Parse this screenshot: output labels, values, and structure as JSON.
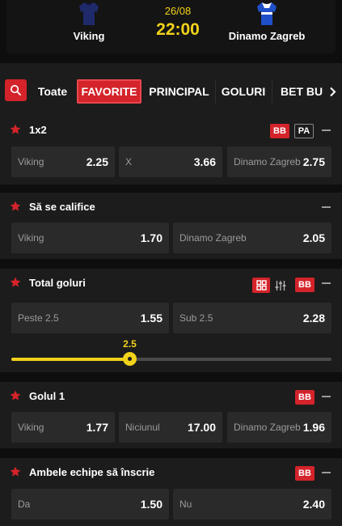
{
  "match": {
    "home_team": "Viking",
    "away_team": "Dinamo Zagreb",
    "date": "26/08",
    "time": "22:00"
  },
  "tabs": [
    {
      "label": "Toate",
      "active": false
    },
    {
      "label": "FAVORITE",
      "active": true
    },
    {
      "label": "PRINCIPAL",
      "active": false
    },
    {
      "label": "GOLURI",
      "active": false
    },
    {
      "label": "BET BU",
      "active": false
    }
  ],
  "badges": {
    "bb": "BB",
    "pa": "PA"
  },
  "markets": [
    {
      "title": "1x2",
      "outcomes": [
        {
          "label": "Viking",
          "odds": "2.25"
        },
        {
          "label": "X",
          "odds": "3.66"
        },
        {
          "label": "Dinamo Zagreb",
          "odds": "2.75"
        }
      ]
    },
    {
      "title": "Să se califice",
      "outcomes": [
        {
          "label": "Viking",
          "odds": "1.70"
        },
        {
          "label": "Dinamo Zagreb",
          "odds": "2.05"
        }
      ]
    },
    {
      "title": "Total goluri",
      "outcomes": [
        {
          "label": "Peste 2.5",
          "odds": "1.55"
        },
        {
          "label": "Sub 2.5",
          "odds": "2.28"
        }
      ],
      "line_slider": {
        "value": "2.5",
        "position_fraction": 0.37
      }
    },
    {
      "title": "Golul 1",
      "outcomes": [
        {
          "label": "Viking",
          "odds": "1.77"
        },
        {
          "label": "Niciunul",
          "odds": "17.00"
        },
        {
          "label": "Dinamo Zagreb",
          "odds": "1.96"
        }
      ]
    },
    {
      "title": "Ambele echipe să înscrie",
      "outcomes": [
        {
          "label": "Da",
          "odds": "1.50"
        },
        {
          "label": "Nu",
          "odds": "2.40"
        }
      ]
    }
  ],
  "colors": {
    "accent_red": "#d4232a",
    "accent_yellow": "#f2d21a",
    "background": "#0e0e0e",
    "card": "#1c1c1c",
    "odd_button": "#2a2a2a"
  },
  "icons": {
    "home_jersey": "shirt-icon",
    "away_jersey": "shirt-icon",
    "search": "search-icon",
    "favorite": "star-icon",
    "collapse": "minus-icon",
    "grid_view": "grid-icon",
    "line_view": "sliders-icon",
    "scroll_tabs": "chevron-right-icon"
  }
}
